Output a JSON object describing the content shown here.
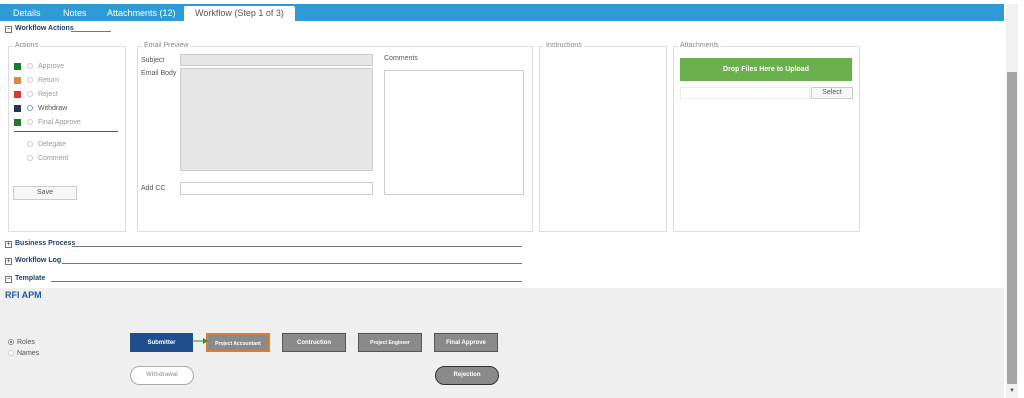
{
  "tabs": [
    {
      "label": "Details"
    },
    {
      "label": "Notes"
    },
    {
      "label": "Attachments (12)"
    },
    {
      "label": "Workflow (Step 1 of 3)",
      "active": true
    }
  ],
  "sections": {
    "workflow_actions": "Workflow Actions",
    "business_process": "Business Process",
    "workflow_log": "Workflow Log",
    "template": "Template",
    "expand_symbol": "+",
    "collapse_symbol": "−"
  },
  "actions": {
    "legend": "Actions",
    "items": [
      {
        "label": "Approve",
        "color": "#1a7a2e",
        "enabled": false,
        "selected": false
      },
      {
        "label": "Return",
        "color": "#d88a4a",
        "enabled": false,
        "selected": false
      },
      {
        "label": "Reject",
        "color": "#e0332c",
        "enabled": false,
        "selected": false
      },
      {
        "label": "Withdraw",
        "color": "#2b3550",
        "enabled": true,
        "selected": false
      },
      {
        "label": "Final Approve",
        "color": "#1a7a2e",
        "enabled": false,
        "selected": false
      }
    ],
    "secondary": [
      {
        "label": "Delegate"
      },
      {
        "label": "Comment"
      }
    ],
    "save_label": "Save"
  },
  "email_preview": {
    "legend": "Email Preview",
    "subject_label": "Subject",
    "body_label": "Email Body",
    "add_cc_label": "Add CC",
    "comments_label": "Comments"
  },
  "instructions": {
    "legend": "Instructions"
  },
  "attachments": {
    "legend": "Attachments",
    "drop_label": "Drop Files Here to Upload",
    "select_label": "Select",
    "drop_color": "#6ab04c"
  },
  "template": {
    "title": "RFI APM",
    "view_options": [
      {
        "label": "Roles",
        "selected": true
      },
      {
        "label": "Names",
        "selected": false
      }
    ],
    "nodes": [
      {
        "label": "Submitter",
        "bg": "#1f4e8c",
        "border": "#1f4e8c"
      },
      {
        "label": "Project Accountant",
        "bg": "#8a8a8a",
        "border": "#e07a2e"
      },
      {
        "label": "Contruction",
        "bg": "#8a8a8a",
        "border": "#555"
      },
      {
        "label": "Project Engineer",
        "bg": "#8a8a8a",
        "border": "#555"
      },
      {
        "label": "Final Approve",
        "bg": "#8a8a8a",
        "border": "#555"
      }
    ],
    "withdrawal_label": "Withdrawal",
    "rejection_label": "Rejection",
    "connector_color": "#2e8b3a"
  }
}
